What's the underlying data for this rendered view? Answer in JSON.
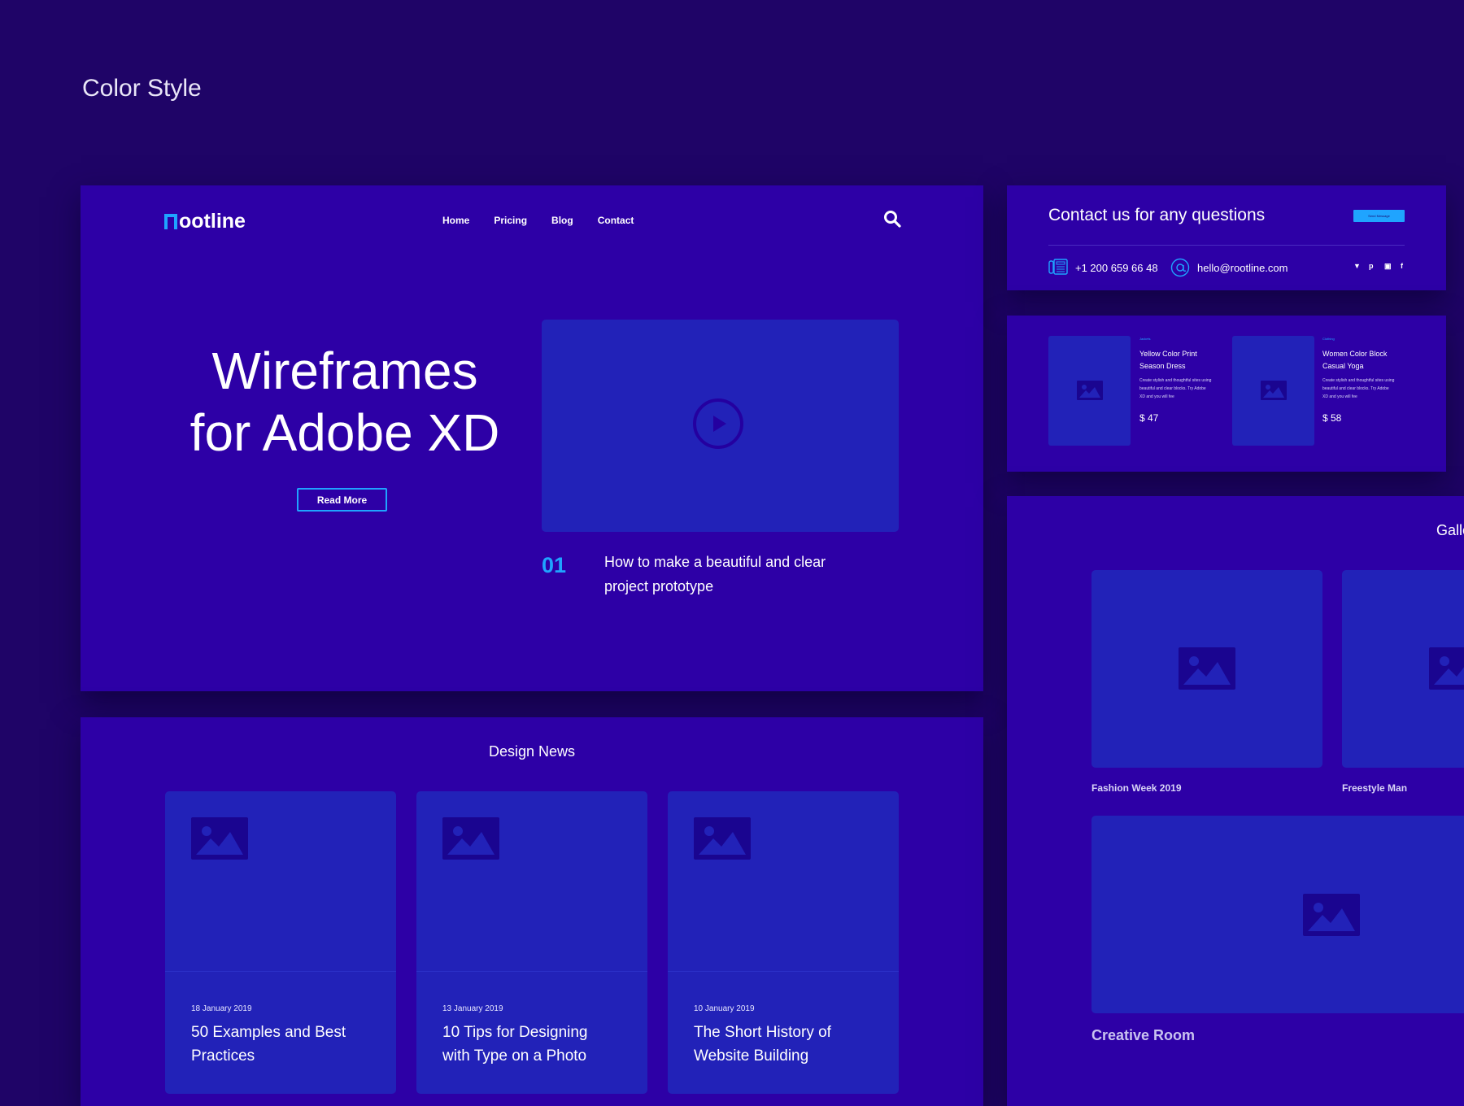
{
  "page": {
    "title": "Color Style"
  },
  "colors": {
    "background": "#1f0467",
    "panel": "#2d00a6",
    "card": "#2222b8",
    "accent": "#1fa4ff"
  },
  "hero": {
    "logo_text": "ootline",
    "nav": [
      "Home",
      "Pricing",
      "Blog",
      "Contact"
    ],
    "search_icon": "search-icon",
    "heading_line1": "Wireframes",
    "heading_line2": "for Adobe XD",
    "read_more": "Read More",
    "story_number": "01",
    "story_line1": "How to make a beautiful and clear",
    "story_line2": "project prototype"
  },
  "news": {
    "title": "Design News",
    "cards": [
      {
        "date": "18 January 2019",
        "line1": "50 Examples and Best",
        "line2": "Practices"
      },
      {
        "date": "13 January 2019",
        "line1": "10 Tips for Designing",
        "line2": "with Type on a Photo"
      },
      {
        "date": "10 January 2019",
        "line1": "The Short History of",
        "line2": "Website Building"
      }
    ]
  },
  "contact": {
    "title": "Contact us for any questions",
    "button": "Send Message",
    "phone": "+1 200 659 66 48",
    "email": "hello@rootline.com",
    "social": [
      "twitter-icon",
      "pinterest-icon",
      "instagram-icon",
      "facebook-icon"
    ]
  },
  "products": [
    {
      "category": "Jackets",
      "line1": "Yellow Color Print",
      "line2": "Season Dress",
      "desc1": "Create stylish and thoughtful sites using",
      "desc2": "beautiful and clear blocks. Try Adobe",
      "desc3": "XD and you will fee",
      "price": "$ 47"
    },
    {
      "category": "Clothing",
      "line1": "Women Color Block",
      "line2": "Casual Yoga",
      "desc1": "Create stylish and thoughtful sites using",
      "desc2": "beautiful and clear blocks. Try Adobe",
      "desc3": "XD and you will fee",
      "price": "$ 58"
    }
  ],
  "gallery": {
    "title": "Galle",
    "captions": [
      "Fashion Week 2019",
      "Freestyle Man",
      "Creative Room"
    ]
  }
}
